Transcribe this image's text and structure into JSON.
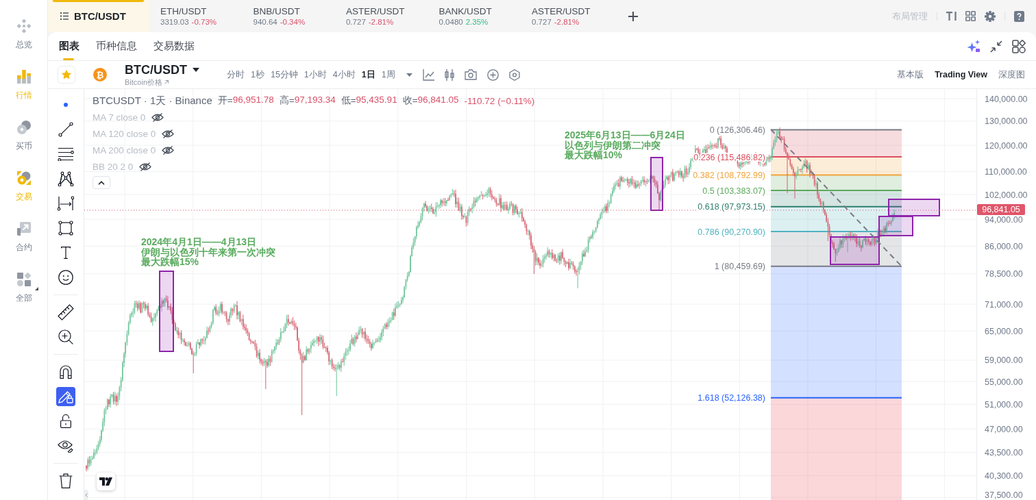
{
  "nav": {
    "items": [
      {
        "kind": "logo",
        "label": "总览",
        "selected": false,
        "has_menu": false
      },
      {
        "kind": "bars",
        "label": "行情",
        "selected": true,
        "has_menu": false
      },
      {
        "kind": "coins",
        "label": "买币",
        "selected": false,
        "has_menu": false
      },
      {
        "kind": "trade",
        "label": "交易",
        "selected": true,
        "has_menu": false
      },
      {
        "kind": "contract",
        "label": "合约",
        "selected": false,
        "has_menu": false
      },
      {
        "kind": "apps",
        "label": "全部",
        "selected": false,
        "has_menu": true
      }
    ]
  },
  "pair_tabs": [
    {
      "symbol": "BTC/USDT",
      "selected": true
    },
    {
      "symbol": "ETH/USDT",
      "price": "3319.03",
      "change": "-0.73%",
      "rising": false,
      "selected": false
    },
    {
      "symbol": "BNB/USDT",
      "price": "940.64",
      "change": "-0.34%",
      "rising": false,
      "selected": false
    },
    {
      "symbol": "ASTER/USDT",
      "price": "0.727",
      "change": "-2.81%",
      "rising": false,
      "selected": false
    },
    {
      "symbol": "BANK/USDT",
      "price": "0.0480",
      "change": "2.35%",
      "rising": true,
      "selected": false
    },
    {
      "symbol": "ASTER/USDT",
      "price": "0.727",
      "change": "-2.81%",
      "rising": false,
      "selected": false
    }
  ],
  "top_actions": {
    "layout_label": "布局管理"
  },
  "view_tabs": [
    {
      "label": "图表",
      "selected": true
    },
    {
      "label": "币种信息",
      "selected": false
    },
    {
      "label": "交易数据",
      "selected": false
    }
  ],
  "symbol_bar": {
    "favorite": true,
    "coin_glyph": "₿",
    "symbol": "BTC/USDT",
    "subtitle": "Bitcoin价格",
    "intervals": [
      {
        "label": "分时",
        "selected": false
      },
      {
        "label": "1秒",
        "selected": false
      },
      {
        "label": "15分钟",
        "selected": false
      },
      {
        "label": "1小时",
        "selected": false
      },
      {
        "label": "4小时",
        "selected": false
      },
      {
        "label": "1日",
        "selected": true
      },
      {
        "label": "1周",
        "selected": false
      }
    ],
    "modes": [
      {
        "label": "基本版",
        "selected": false
      },
      {
        "label": "Trading View",
        "selected": true
      },
      {
        "label": "深度图",
        "selected": false
      }
    ]
  },
  "tool_groups": [
    {
      "tools": [
        {
          "kind": "cursor",
          "on": true
        },
        {
          "kind": "trendline",
          "on": false
        },
        {
          "kind": "fib",
          "on": false
        },
        {
          "kind": "pattern",
          "on": false
        },
        {
          "kind": "measure",
          "on": false
        },
        {
          "kind": "rectangle",
          "on": false
        },
        {
          "kind": "text",
          "on": false
        },
        {
          "kind": "emoji",
          "on": false
        }
      ]
    },
    {
      "tools": [
        {
          "kind": "ruler",
          "on": false
        },
        {
          "kind": "zoom",
          "on": false
        }
      ]
    },
    {
      "tools": [
        {
          "kind": "magnet",
          "on": false
        },
        {
          "kind": "lock",
          "on": true
        },
        {
          "kind": "unlock",
          "on": false
        },
        {
          "kind": "hide",
          "on": false
        }
      ]
    },
    {
      "tools": [
        {
          "kind": "trash",
          "on": false
        }
      ]
    }
  ],
  "chart": {
    "legend": {
      "title": "BTCUSDT · 1天 · Binance",
      "ohlc": [
        {
          "label": "开=",
          "value": "96,951.78"
        },
        {
          "label": "高=",
          "value": "97,193.34"
        },
        {
          "label": "低=",
          "value": "95,435.91"
        },
        {
          "label": "收=",
          "value": "96,841.05"
        }
      ],
      "change": "-110.72 (−0.11%)",
      "rising": false
    },
    "indicators": [
      {
        "label": "MA 7 close 0",
        "visible": false
      },
      {
        "label": "MA 120 close 0",
        "visible": false
      },
      {
        "label": "MA 200 close 0",
        "visible": false
      },
      {
        "label": "BB 20 2 0",
        "visible": false
      }
    ],
    "legend_expanded": true,
    "annotations": [
      {
        "lines": [
          "2024年4月1日——4月13日",
          "伊朗与以色列十年来第一次冲突",
          "最大跌幅15%"
        ]
      },
      {
        "lines": [
          "2025年6月13日——6月24日",
          "以色列与伊朗第二冲突",
          "最大跌幅10%"
        ]
      }
    ],
    "fib_levels": [
      {
        "label": "0 (126,306.46)",
        "color": "#787b86"
      },
      {
        "label": "0.236 (115,486.82)",
        "color": "#d9505e"
      },
      {
        "label": "0.382 (108,792.99)",
        "color": "#f0a43a"
      },
      {
        "label": "0.5 (103,383.07)",
        "color": "#5daa5d"
      },
      {
        "label": "0.618 (97,973.15)",
        "color": "#2e7f6e"
      },
      {
        "label": "0.786 (90,270.90)",
        "color": "#4fb2bf"
      },
      {
        "label": "1 (80,459.69)",
        "color": "#787b86"
      },
      {
        "label": "1.618 (52,126.38)",
        "color": "#2962ff"
      }
    ]
  },
  "price_axis": {
    "labels": [
      "140,000.00",
      "130,000.00",
      "120,000.00",
      "110,000.00",
      "102,000.00",
      "94,000.00",
      "86,000.00",
      "78,500.00",
      "71,000.00",
      "65,000.00",
      "59,000.00",
      "55,000.00",
      "51,000.00",
      "47,000.00",
      "43,500.00",
      "40,300.00",
      "37,500.00"
    ],
    "last_price": "96,841.05"
  }
}
